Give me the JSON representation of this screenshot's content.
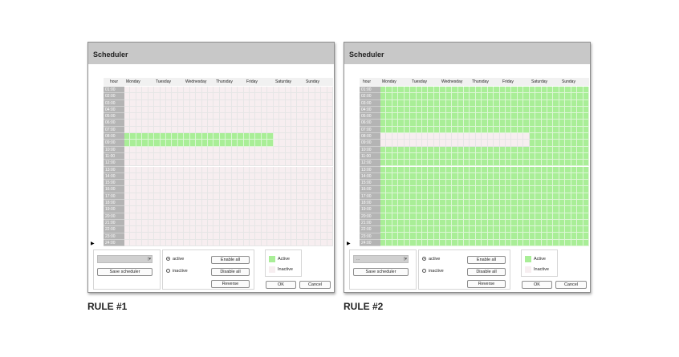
{
  "colors": {
    "active": "#a9ee97",
    "inactive": "#f7eef0",
    "hour_column": "#b4b4b4",
    "titlebar": "#c8c8c8"
  },
  "hours": [
    "01:00",
    "02:00",
    "03:00",
    "04:00",
    "05:00",
    "06:00",
    "07:00",
    "08:00",
    "09:00",
    "10:00",
    "11:00",
    "12:00",
    "13:00",
    "14:00",
    "15:00",
    "16:00",
    "17:00",
    "18:00",
    "19:00",
    "20:00",
    "21:00",
    "22:00",
    "23:00",
    "24:00"
  ],
  "schedulers": [
    {
      "title": "Scheduler",
      "caption": "RULE #1",
      "hour_label": "hour",
      "days": [
        "Monday",
        "Tuesday",
        "Wednesday",
        "Thursday",
        "Friday",
        "Saturday",
        "Sunday"
      ],
      "schedule": {
        "active_days": [
          0,
          1,
          2,
          3,
          4
        ],
        "active_hours": [
          8,
          9
        ],
        "mode": "only_selected_active"
      },
      "combo_value": "",
      "buttons": {
        "save": "Save scheduler",
        "enable_all": "Enable all",
        "disable_all": "Disable all",
        "reverse": "Reverse",
        "ok": "OK",
        "cancel": "Cancel"
      },
      "radios": {
        "active": "active",
        "inactive": "inactive",
        "selected": "active"
      },
      "legend": {
        "active": "Active",
        "inactive": "Inactive"
      }
    },
    {
      "title": "Scheduler",
      "caption": "RULE #2",
      "hour_label": "hour",
      "days": [
        "Monday",
        "Tuesday",
        "Wednesday",
        "Thursday",
        "Friday",
        "Saturday",
        "Sunday"
      ],
      "schedule": {
        "inactive_days": [
          0,
          1,
          2,
          3,
          4
        ],
        "inactive_hours": [
          8,
          9
        ],
        "mode": "only_selected_inactive"
      },
      "combo_value": "...",
      "buttons": {
        "save": "Save scheduler",
        "enable_all": "Enable all",
        "disable_all": "Disable all",
        "reverse": "Reverse",
        "ok": "OK",
        "cancel": "Cancel"
      },
      "radios": {
        "active": "active",
        "inactive": "inactive",
        "selected": "active"
      },
      "legend": {
        "active": "Active",
        "inactive": "Inactive"
      }
    }
  ]
}
